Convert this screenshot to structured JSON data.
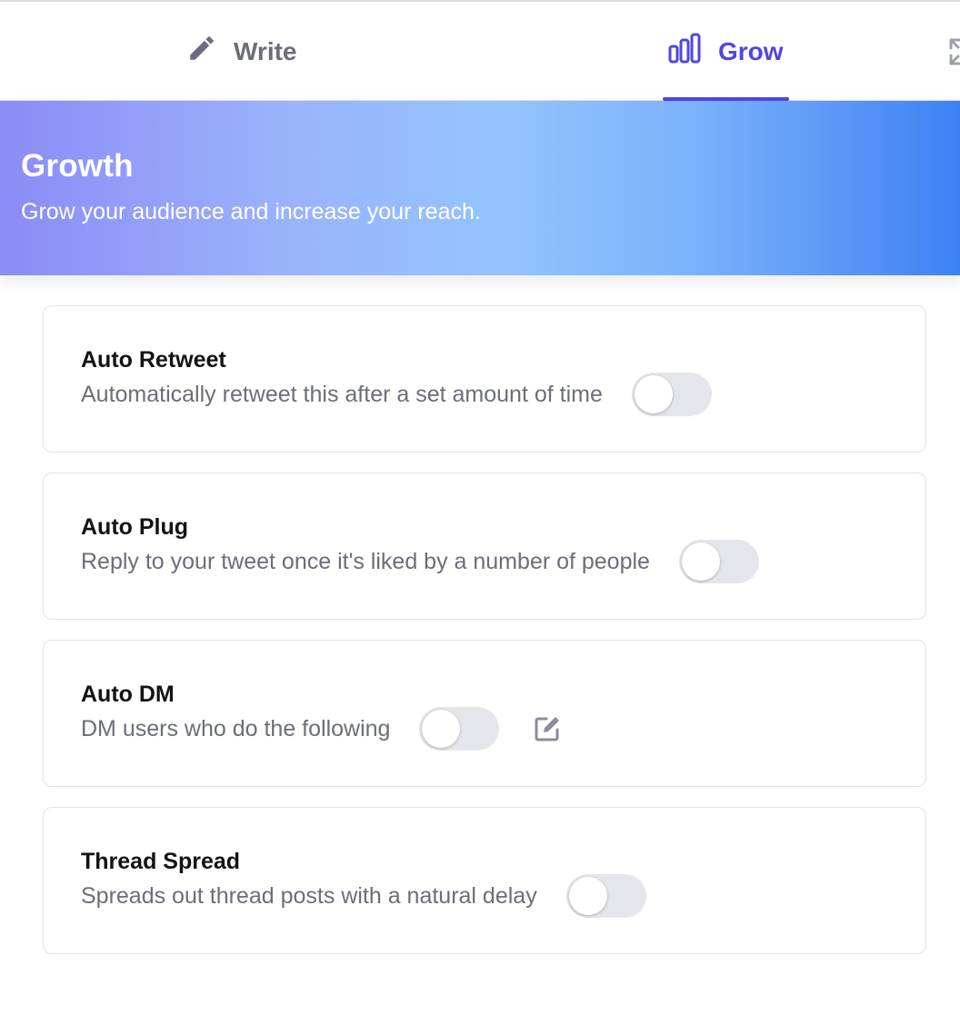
{
  "tabs": {
    "write_label": "Write",
    "grow_label": "Grow",
    "active": "grow",
    "icons": {
      "write": "pencil-icon",
      "grow": "bar-chart-icon",
      "extra": "expand-icon"
    }
  },
  "header": {
    "title": "Growth",
    "subtitle": "Grow your audience and increase your reach."
  },
  "features": [
    {
      "title": "Auto Retweet",
      "description": "Automatically retweet this after a set amount of time",
      "enabled": false
    },
    {
      "title": "Auto Plug",
      "description": "Reply to your tweet once it's liked by a number of people",
      "enabled": false
    },
    {
      "title": "Auto DM",
      "description": "DM users who do the following",
      "enabled": false,
      "has_edit": true,
      "edit_icon": "edit-icon"
    },
    {
      "title": "Thread Spread",
      "description": "Spreads out thread posts with a natural delay",
      "enabled": false
    }
  ],
  "colors": {
    "accent": "#4f46e5",
    "muted_text": "#6b6e7a",
    "toggle_off": "#e5e6eb",
    "banner_start": "#8b8cf6",
    "banner_end": "#3b82f6"
  }
}
